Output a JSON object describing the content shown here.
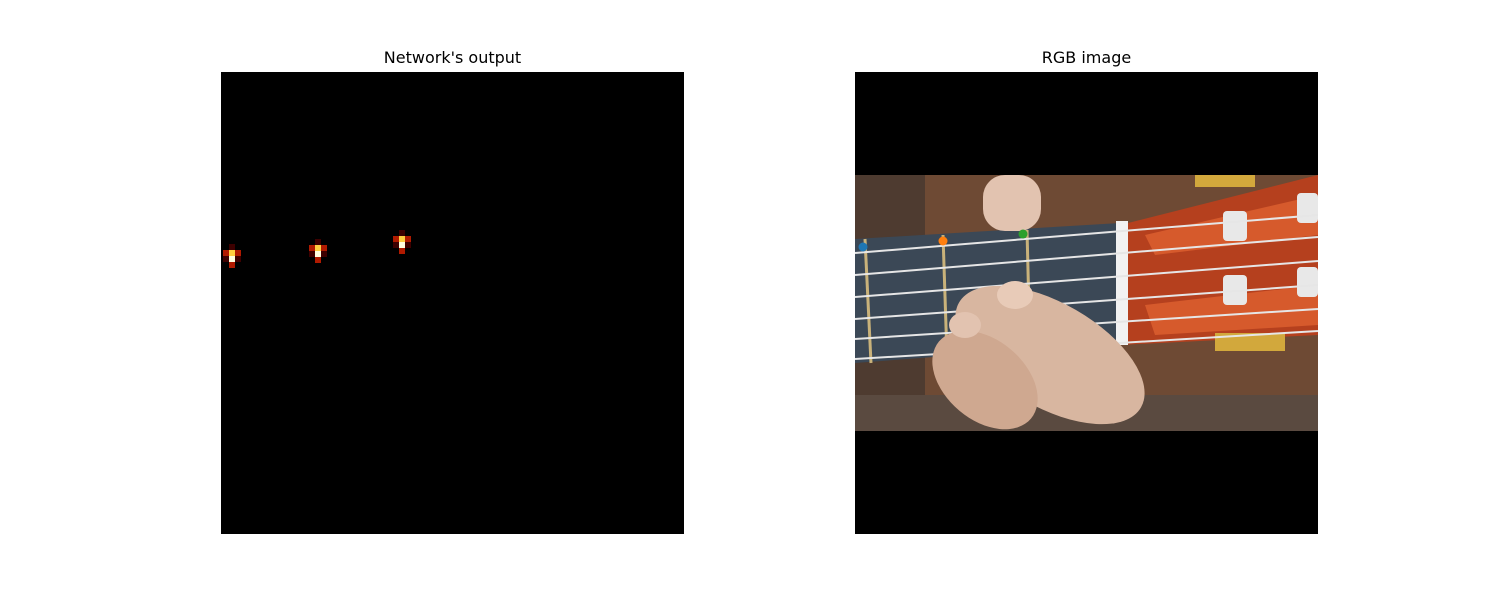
{
  "left_panel": {
    "title": "Network's output",
    "heatmap_peaks": [
      {
        "level": 1.0
      },
      {
        "level": 0.95
      },
      {
        "level": 0.9
      }
    ]
  },
  "right_panel": {
    "title": "RGB image",
    "keypoints": [
      {
        "color": "#1f77b4"
      },
      {
        "color": "#ff7f0e"
      },
      {
        "color": "#2ca02c"
      }
    ]
  },
  "colors": {
    "heat_low": "#3d0000",
    "heat_mid": "#b01a00",
    "heat_high": "#ffcf40",
    "heat_peak": "#ffffe0"
  }
}
